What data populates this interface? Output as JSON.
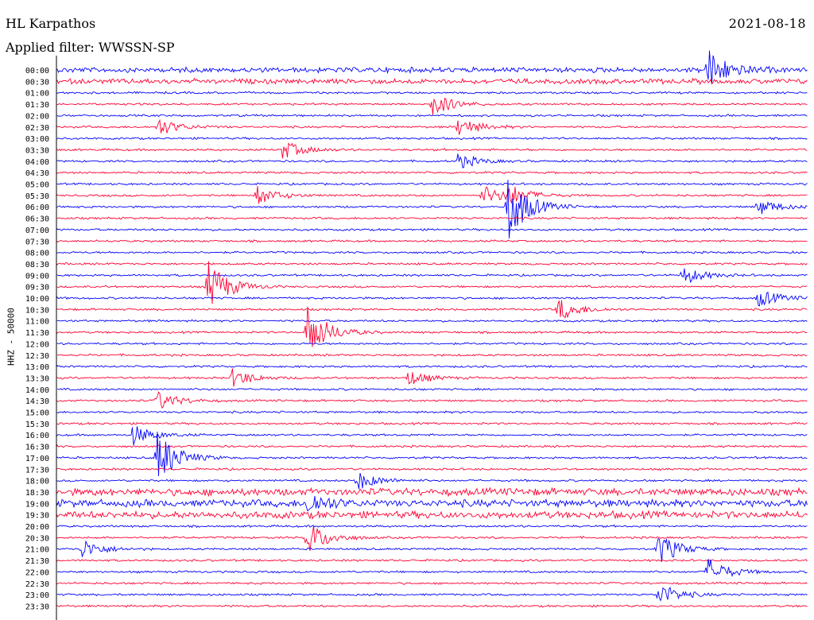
{
  "header": {
    "station": "HL Karpathos",
    "date": "2021-08-18",
    "filter_label": "Applied filter: WWSSN-SP"
  },
  "axis": {
    "ylabel": "HHZ - 50000"
  },
  "chart_data": {
    "type": "line",
    "title": "HL Karpathos",
    "subtitle": "Applied filter: WWSSN-SP",
    "ylabel": "HHZ - 50000",
    "rows": [
      "00:00",
      "00:30",
      "01:00",
      "01:30",
      "02:00",
      "02:30",
      "03:00",
      "03:30",
      "04:00",
      "04:30",
      "05:00",
      "05:30",
      "06:00",
      "06:30",
      "07:00",
      "07:30",
      "08:00",
      "08:30",
      "09:00",
      "09:30",
      "10:00",
      "10:30",
      "11:00",
      "11:30",
      "12:00",
      "12:30",
      "13:00",
      "13:30",
      "14:00",
      "14:30",
      "15:00",
      "15:30",
      "16:00",
      "16:30",
      "17:00",
      "17:30",
      "18:00",
      "18:30",
      "19:00",
      "19:30",
      "20:00",
      "20:30",
      "21:00",
      "21:30",
      "22:00",
      "22:30",
      "23:00",
      "23:30"
    ],
    "row_minutes": 30,
    "colors": [
      "#0000ff",
      "#ff0033"
    ],
    "events": [
      {
        "row": 0,
        "minute": 26,
        "amp": 2.6
      },
      {
        "row": 3,
        "minute": 15,
        "amp": 1.5
      },
      {
        "row": 5,
        "minute": 4,
        "amp": 1.2
      },
      {
        "row": 5,
        "minute": 16,
        "amp": 1.3
      },
      {
        "row": 7,
        "minute": 9,
        "amp": 1.2
      },
      {
        "row": 8,
        "minute": 16,
        "amp": 1.0
      },
      {
        "row": 11,
        "minute": 8,
        "amp": 1.2
      },
      {
        "row": 11,
        "minute": 17,
        "amp": 1.3
      },
      {
        "row": 11,
        "minute": 18,
        "amp": 1.3
      },
      {
        "row": 12,
        "minute": 18,
        "amp": 4.5
      },
      {
        "row": 12,
        "minute": 28,
        "amp": 1.1
      },
      {
        "row": 18,
        "minute": 25,
        "amp": 1.2
      },
      {
        "row": 19,
        "minute": 6,
        "amp": 3.5
      },
      {
        "row": 20,
        "minute": 28,
        "amp": 1.2
      },
      {
        "row": 21,
        "minute": 20,
        "amp": 1.6
      },
      {
        "row": 23,
        "minute": 10,
        "amp": 3.5
      },
      {
        "row": 27,
        "minute": 7,
        "amp": 1.2
      },
      {
        "row": 27,
        "minute": 14,
        "amp": 1.0
      },
      {
        "row": 29,
        "minute": 4,
        "amp": 1.2
      },
      {
        "row": 32,
        "minute": 3,
        "amp": 1.3
      },
      {
        "row": 34,
        "minute": 4,
        "amp": 3.5
      },
      {
        "row": 36,
        "minute": 12,
        "amp": 1.2
      },
      {
        "row": 38,
        "minute": 10,
        "amp": 1.4
      },
      {
        "row": 41,
        "minute": 10,
        "amp": 2.2
      },
      {
        "row": 42,
        "minute": 1,
        "amp": 1.2
      },
      {
        "row": 42,
        "minute": 24,
        "amp": 2.2
      },
      {
        "row": 44,
        "minute": 26,
        "amp": 1.8
      },
      {
        "row": 46,
        "minute": 24,
        "amp": 1.6
      }
    ]
  }
}
